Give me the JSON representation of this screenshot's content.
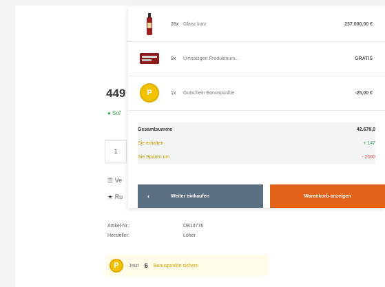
{
  "product": {
    "price_partial": "449",
    "availability_partial": "● Sof",
    "quantity": "1",
    "line_a": "☰ Ve",
    "line_b": "★ Ru",
    "props": [
      {
        "key": "Artikel-Nr.:",
        "value": "DB10776"
      },
      {
        "key": "Hersteller:",
        "value": "Loher"
      }
    ],
    "bonus": {
      "coin": "P",
      "prefix": "Jetzt",
      "points": "6",
      "link": "Bonuspunkte sichern"
    }
  },
  "cart": {
    "items": [
      {
        "qty": "28x",
        "name": "Glanz kurz",
        "amount": "237.000,00 €",
        "thumb": "bottle-icon"
      },
      {
        "qty": "9x",
        "name": "Umsatzgen Produktnum...",
        "amount": "GRATIS",
        "thumb": "product-box-icon"
      },
      {
        "qty": "1x",
        "name": "Gutschein Bonuspunkte",
        "amount": "-25,00 €",
        "thumb": "bonus-coin-icon",
        "coin": "P"
      }
    ],
    "summary": {
      "total_label": "Gesamtsumme",
      "total_value": "42.678,0",
      "earn_label": "Sie erhalten",
      "earn_value": "+ 147",
      "save_label": "Sie Sparen um",
      "save_value": "- 2500"
    },
    "continue_label": "Weiter einkaufen",
    "continue_chevron": "‹",
    "cart_label": "Warenkorb anzeigen"
  },
  "colors": {
    "accent_orange": "#e2621a",
    "button_slate": "#5b6f82",
    "bonus_gold": "#f2c200",
    "success_green": "#3aa55b",
    "danger_red": "#e05050"
  }
}
